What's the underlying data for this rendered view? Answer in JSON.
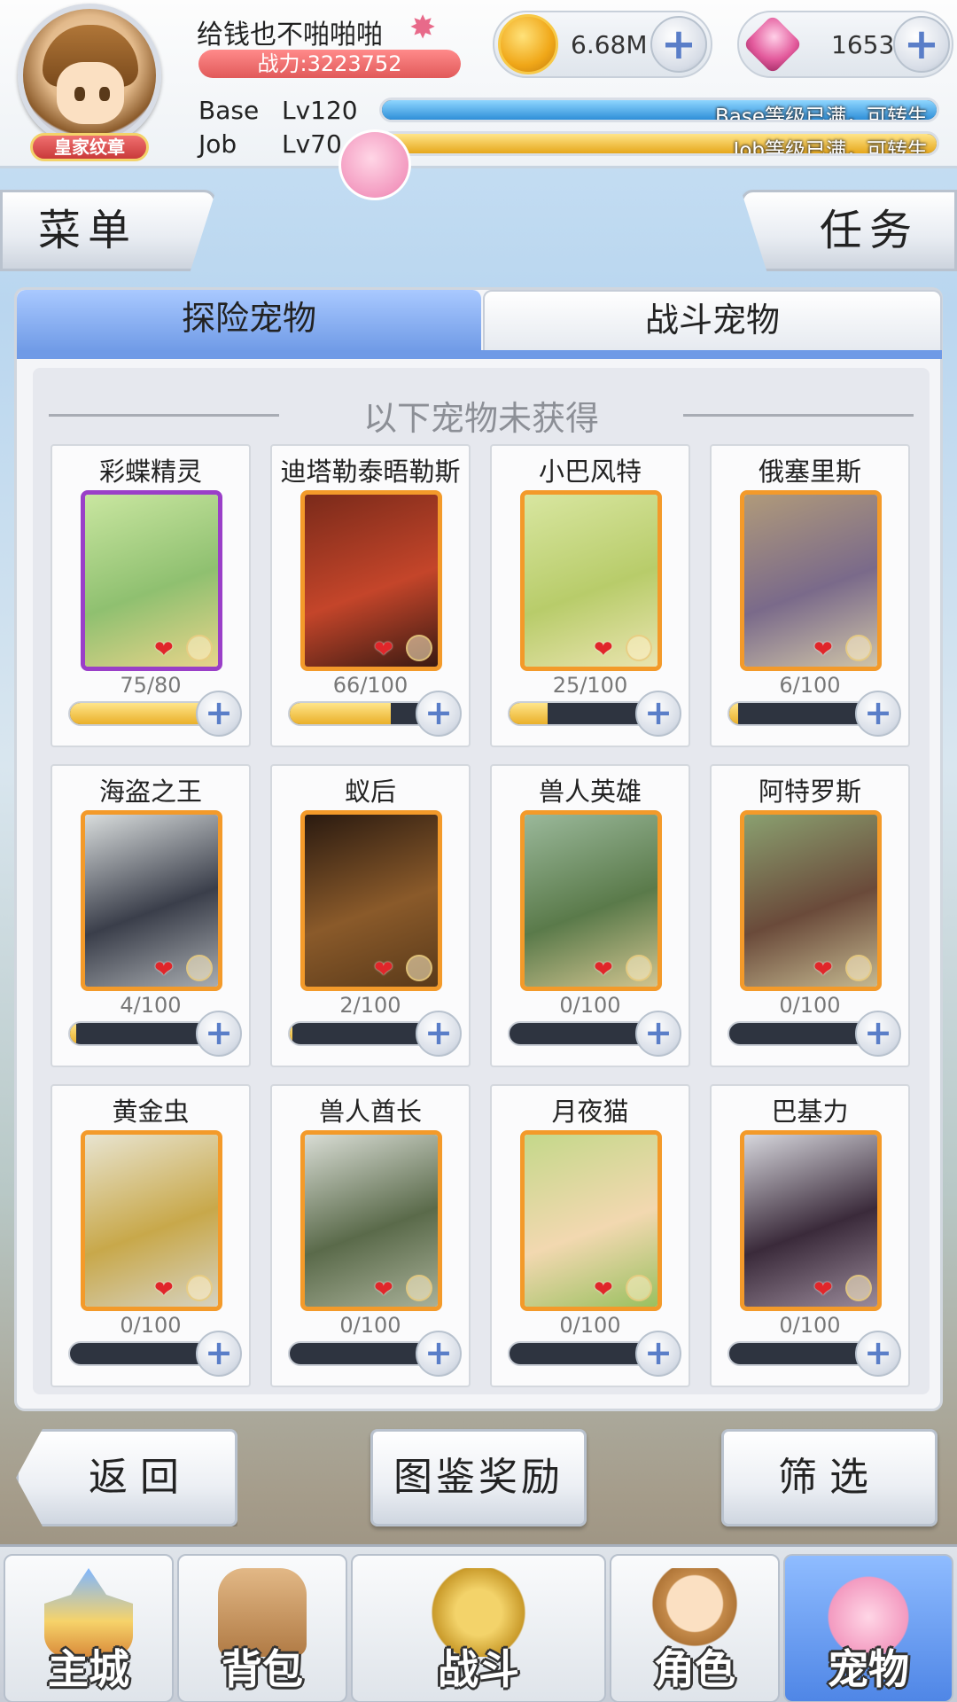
{
  "header": {
    "badge": "皇家纹章",
    "player_name": "给钱也不啪啪啪",
    "power": "战力:3223752",
    "base_label": "Base",
    "base_level": "Lv120",
    "base_bar_text": "Base等级已满，可转生",
    "job_label": "Job",
    "job_level": "Lv70",
    "job_bar_text": "Job等级已满，可转生",
    "coin_value": "6.68M",
    "gem_value": "1653",
    "plus": "+"
  },
  "nav_buttons": {
    "menu": "菜单",
    "task": "任务"
  },
  "tabs": [
    {
      "label": "探险宠物",
      "active": true
    },
    {
      "label": "战斗宠物",
      "active": false
    }
  ],
  "section_title": "以下宠物未获得",
  "pets": [
    {
      "name": "彩蝶精灵",
      "count": "75/80",
      "progress": 0.94,
      "frame": "purple",
      "art": [
        "#c9e6a0",
        "#8fc070",
        "#e8d48a"
      ]
    },
    {
      "name": "迪塔勒泰晤勒斯",
      "count": "66/100",
      "progress": 0.66,
      "frame": "orange",
      "art": [
        "#7a2a1a",
        "#c4452a",
        "#3a1a12"
      ]
    },
    {
      "name": "小巴风特",
      "count": "25/100",
      "progress": 0.25,
      "frame": "orange",
      "art": [
        "#d8e6a0",
        "#b8cc6a",
        "#eae4b0"
      ]
    },
    {
      "name": "俄塞里斯",
      "count": "6/100",
      "progress": 0.06,
      "frame": "orange",
      "art": [
        "#b09a7a",
        "#7a6a8a",
        "#cfc4a8"
      ]
    },
    {
      "name": "海盗之王",
      "count": "4/100",
      "progress": 0.04,
      "frame": "orange",
      "art": [
        "#d8dcdc",
        "#3a3e4a",
        "#a8acb0"
      ]
    },
    {
      "name": "蚁后",
      "count": "2/100",
      "progress": 0.02,
      "frame": "orange",
      "art": [
        "#2a1a10",
        "#8a5a2a",
        "#5a3a1a"
      ]
    },
    {
      "name": "兽人英雄",
      "count": "0/100",
      "progress": 0,
      "frame": "orange",
      "art": [
        "#9ab89a",
        "#5a7a4a",
        "#d0c490"
      ]
    },
    {
      "name": "阿特罗斯",
      "count": "0/100",
      "progress": 0,
      "frame": "orange",
      "art": [
        "#8aa070",
        "#6a4a3a",
        "#c4b890"
      ]
    },
    {
      "name": "黄金虫",
      "count": "0/100",
      "progress": 0,
      "frame": "orange",
      "art": [
        "#e8e4d0",
        "#c8a84a",
        "#d6d2c0"
      ]
    },
    {
      "name": "兽人酋长",
      "count": "0/100",
      "progress": 0,
      "frame": "orange",
      "art": [
        "#d8dcd4",
        "#5a6a4a",
        "#a8b098"
      ]
    },
    {
      "name": "月夜猫",
      "count": "0/100",
      "progress": 0,
      "frame": "orange",
      "art": [
        "#c4d88a",
        "#f2d8b0",
        "#9ac060"
      ]
    },
    {
      "name": "巴基力",
      "count": "0/100",
      "progress": 0,
      "frame": "orange",
      "art": [
        "#d6d6dc",
        "#3a2a3a",
        "#9a8a9a"
      ]
    }
  ],
  "actions": {
    "back": "返回",
    "reward": "图鉴奖励",
    "filter": "筛选"
  },
  "bottom_nav": [
    {
      "label": "主城",
      "icon": "castle-icon",
      "active": false
    },
    {
      "label": "背包",
      "icon": "backpack-icon",
      "active": false
    },
    {
      "label": "战斗",
      "icon": "crossed-swords-icon",
      "active": false
    },
    {
      "label": "角色",
      "icon": "character-icon",
      "active": false
    },
    {
      "label": "宠物",
      "icon": "poring-icon",
      "active": true
    }
  ]
}
